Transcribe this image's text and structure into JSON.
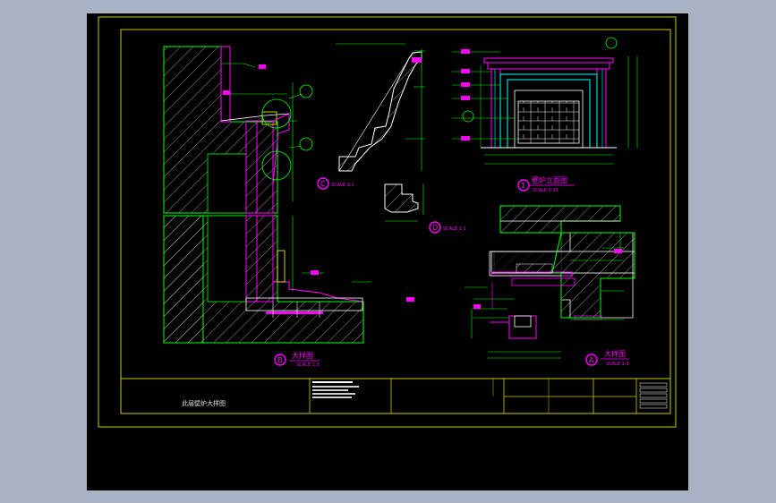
{
  "app": {
    "background_color": "#a9b2c2",
    "viewport_color": "#000000"
  },
  "colors": {
    "frame": "#c8c800",
    "line_green": "#00ff00",
    "line_magenta": "#ff00ff",
    "line_cyan": "#00ffff",
    "line_white": "#ffffff",
    "line_yellow": "#ffff00",
    "hatch": "#ffffff"
  },
  "details": {
    "fireplace": {
      "marker": "1",
      "title": "壁炉立面图",
      "scale": "SCALE 1:15"
    },
    "detail_a": {
      "marker": "A",
      "title": "大样图",
      "scale": "SCALE 1:3"
    },
    "detail_b": {
      "marker": "B",
      "title": "大样图",
      "scale": "SCALE 1:3"
    },
    "detail_c": {
      "marker": "C",
      "scale": "SCALE 1:1"
    },
    "detail_d": {
      "marker": "D",
      "scale": "SCALE 1:1"
    }
  },
  "title_block": {
    "drawing_name": "此层壁炉大样图"
  }
}
